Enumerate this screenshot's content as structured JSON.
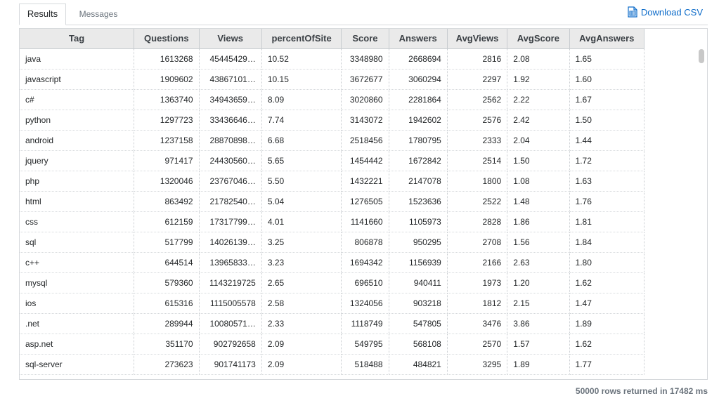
{
  "tabs": {
    "results": "Results",
    "messages": "Messages"
  },
  "download": {
    "label": "Download CSV",
    "icon": "csv-file-icon"
  },
  "columns": [
    "Tag",
    "Questions",
    "Views",
    "percentOfSite",
    "Score",
    "Answers",
    "AvgViews",
    "AvgScore",
    "AvgAnswers"
  ],
  "rows": [
    [
      "java",
      "1613268",
      "45445429…",
      "10.52",
      "3348980",
      "2668694",
      "2816",
      "2.08",
      "1.65"
    ],
    [
      "javascript",
      "1909602",
      "43867101…",
      "10.15",
      "3672677",
      "3060294",
      "2297",
      "1.92",
      "1.60"
    ],
    [
      "c#",
      "1363740",
      "34943659…",
      "8.09",
      "3020860",
      "2281864",
      "2562",
      "2.22",
      "1.67"
    ],
    [
      "python",
      "1297723",
      "33436646…",
      "7.74",
      "3143072",
      "1942602",
      "2576",
      "2.42",
      "1.50"
    ],
    [
      "android",
      "1237158",
      "28870898…",
      "6.68",
      "2518456",
      "1780795",
      "2333",
      "2.04",
      "1.44"
    ],
    [
      "jquery",
      "971417",
      "24430560…",
      "5.65",
      "1454442",
      "1672842",
      "2514",
      "1.50",
      "1.72"
    ],
    [
      "php",
      "1320046",
      "23767046…",
      "5.50",
      "1432221",
      "2147078",
      "1800",
      "1.08",
      "1.63"
    ],
    [
      "html",
      "863492",
      "21782540…",
      "5.04",
      "1276505",
      "1523636",
      "2522",
      "1.48",
      "1.76"
    ],
    [
      "css",
      "612159",
      "17317799…",
      "4.01",
      "1141660",
      "1105973",
      "2828",
      "1.86",
      "1.81"
    ],
    [
      "sql",
      "517799",
      "14026139…",
      "3.25",
      "806878",
      "950295",
      "2708",
      "1.56",
      "1.84"
    ],
    [
      "c++",
      "644514",
      "13965833…",
      "3.23",
      "1694342",
      "1156939",
      "2166",
      "2.63",
      "1.80"
    ],
    [
      "mysql",
      "579360",
      "1143219725",
      "2.65",
      "696510",
      "940411",
      "1973",
      "1.20",
      "1.62"
    ],
    [
      "ios",
      "615316",
      "1115005578",
      "2.58",
      "1324056",
      "903218",
      "1812",
      "2.15",
      "1.47"
    ],
    [
      ".net",
      "289944",
      "10080571…",
      "2.33",
      "1118749",
      "547805",
      "3476",
      "3.86",
      "1.89"
    ],
    [
      "asp.net",
      "351170",
      "902792658",
      "2.09",
      "549795",
      "568108",
      "2570",
      "1.57",
      "1.62"
    ],
    [
      "sql-server",
      "273623",
      "901741173",
      "2.09",
      "518488",
      "484821",
      "3295",
      "1.89",
      "1.77"
    ]
  ],
  "status": "50000 rows returned in 17482 ms"
}
